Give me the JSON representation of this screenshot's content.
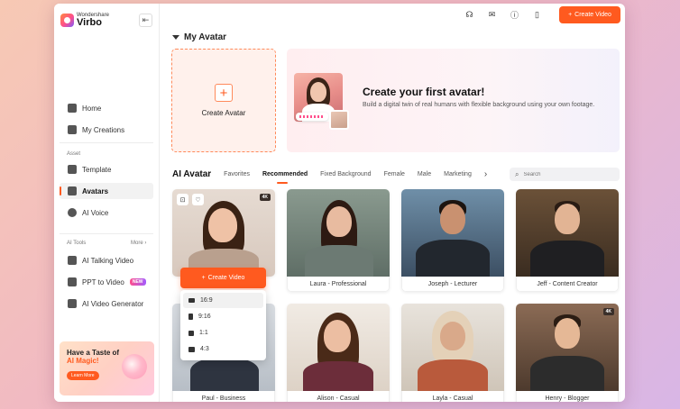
{
  "app": {
    "logo_small": "Wondershare",
    "logo_big": "Virbo"
  },
  "sidebar": {
    "items": [
      {
        "label": "Home"
      },
      {
        "label": "My Creations"
      }
    ],
    "asset_label": "Asset",
    "asset_items": [
      {
        "label": "Template"
      },
      {
        "label": "Avatars"
      },
      {
        "label": "AI Voice"
      }
    ],
    "tools_label": "AI Tools",
    "more_label": "More",
    "tool_items": [
      {
        "label": "AI Talking Video"
      },
      {
        "label": "PPT to Video",
        "badge": "NEW"
      },
      {
        "label": "AI Video Generator"
      }
    ],
    "promo": {
      "line1": "Have a Taste of",
      "line2": "AI Magic!",
      "button": "Learn More"
    }
  },
  "topbar": {
    "create_button": "Create Video",
    "icons": [
      "headset-icon",
      "mail-icon",
      "help-icon",
      "bookmark-icon"
    ]
  },
  "my_avatar": {
    "title": "My Avatar",
    "create_label": "Create Avatar",
    "banner_title": "Create your first avatar!",
    "banner_text": "Build a digital twin of real humans with flexible background using your own footage."
  },
  "ai_avatar": {
    "title": "AI Avatar",
    "tabs": [
      "Favorites",
      "Recommended",
      "Fixed Background",
      "Female",
      "Male",
      "Marketing"
    ],
    "active_tab": "Recommended",
    "search_placeholder": "Search"
  },
  "avatars": [
    {
      "name": "",
      "badge": "4K"
    },
    {
      "name": "Laura - Professional"
    },
    {
      "name": "Joseph - Lecturer"
    },
    {
      "name": "Jeff - Content Creator"
    },
    {
      "name": "Paul - Business"
    },
    {
      "name": "Alison - Casual"
    },
    {
      "name": "Layla - Casual"
    },
    {
      "name": "Henry - Blogger",
      "badge": "4K"
    }
  ],
  "overlay": {
    "create_label": "Create Video",
    "ratios": [
      "16:9",
      "9:16",
      "1:1",
      "4:3"
    ],
    "selected": "16:9"
  },
  "colors": {
    "accent": "#ff5a1f"
  }
}
